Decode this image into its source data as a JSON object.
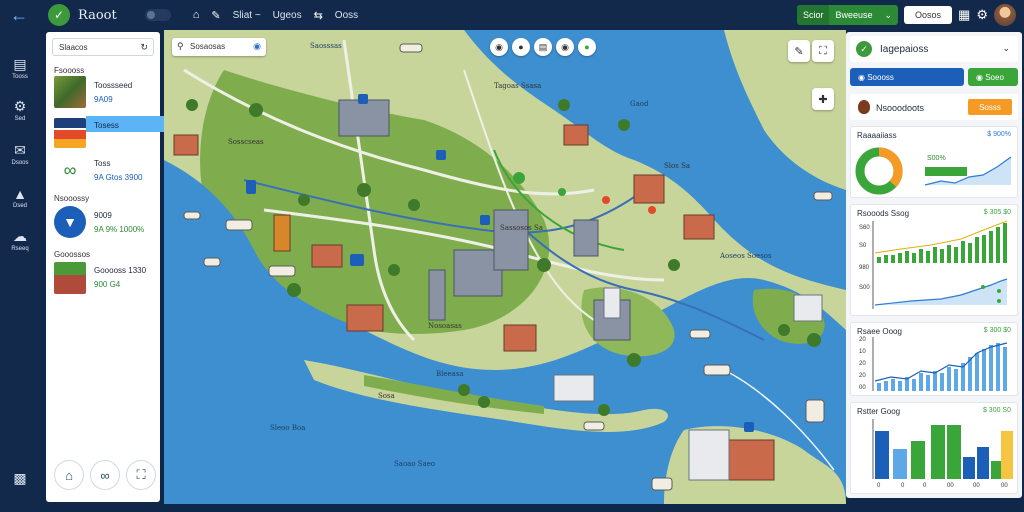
{
  "header": {
    "app_title": "Raoot",
    "nav": [
      "Sliat ~",
      "Ugeos",
      "Ooss"
    ],
    "actions": {
      "green_a": "Scior",
      "green_b": "Bweeuse",
      "white": "Oosos"
    }
  },
  "rail": [
    "Tooss",
    "Sed",
    "Dsoos",
    "Dsed",
    "Rseeq"
  ],
  "left_panel": {
    "search": "Slaacos",
    "sections": [
      {
        "title": "Fsoooss",
        "lines": [
          "Toossseed",
          "9A09"
        ]
      },
      {
        "title": "",
        "lines": [
          "Tosess",
          ""
        ]
      },
      {
        "title": "",
        "lines": [
          "Toss",
          "9A Gtos 3900"
        ]
      },
      {
        "title": "Nsooossy",
        "lines": [
          "9009",
          "9A 9% 1000%"
        ]
      },
      {
        "title": "Gooossos",
        "lines": [
          "Gooooss  1330",
          "900 G4"
        ]
      }
    ]
  },
  "map": {
    "search": "Sosaosas",
    "labels": [
      "Saosssas",
      "Gaod",
      "Sosscseas",
      "Tagoas Ssasa",
      "Slos Sa",
      "Sassosos Sa",
      "Nosoasas",
      "Bleeasa",
      "Sosa",
      "Sleoo Boa",
      "Saoao Saeo",
      "Aoseos Soesos"
    ]
  },
  "right_panel": {
    "title": "Iagepaioss",
    "btn_blue": "Soooss",
    "btn_green": "Soeo",
    "section_title": "Nsooodoots",
    "section_btn": "Sosss",
    "cards": [
      {
        "title": "Raaaaiiass",
        "value": "$ 900%",
        "inner": "S00%"
      },
      {
        "title": "Rsooods Ssog",
        "value": "$ 305 $0",
        "axis": [
          "S60",
          "S0",
          "980",
          "S00"
        ]
      },
      {
        "title": "Rsaee Ooog",
        "value": "$ 300 $0",
        "axis": [
          "20",
          "10",
          "20",
          "20",
          "00"
        ]
      },
      {
        "title": "Rstter Goog",
        "value": "$ 300 S0",
        "axis": [
          "0",
          "0",
          "0",
          "00",
          "00",
          "00"
        ]
      }
    ]
  },
  "colors": {
    "accent_blue": "#1b5fb8",
    "accent_green": "#3aa63a",
    "accent_orange": "#f59a24",
    "sea": "#3d8fd0",
    "land": "#c7d59a"
  }
}
